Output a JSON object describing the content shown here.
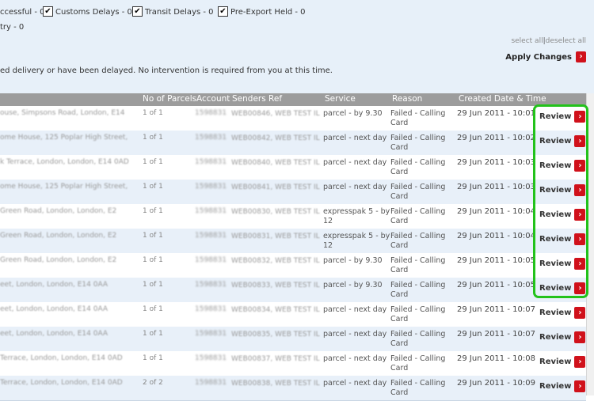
{
  "filters": [
    {
      "label": "ccessful - 0",
      "checked": false
    },
    {
      "label": "Customs Delays - 0",
      "checked": true
    },
    {
      "label": "Transit Delays - 0",
      "checked": true
    },
    {
      "label": "Pre-Export Held - 0",
      "checked": true
    }
  ],
  "filters_line2": "try - 0",
  "select_all": "select all",
  "select_sep": "|",
  "deselect_all": "deselect all",
  "apply_changes": "Apply Changes",
  "notice": "ed delivery or have been delayed. No intervention is required from you at this time.",
  "table": {
    "headers": {
      "parcels": "No of Parcels",
      "account": "Account",
      "senders_ref": "Senders Ref",
      "service": "Service",
      "reason": "Reason",
      "created": "Created Date & Time"
    },
    "review_label": "Review",
    "rows": [
      {
        "address": "ouse, Simpsons Road, London, E14",
        "parcels": "1 of 1",
        "account": "1598831",
        "senders_ref": "WEB00846, WEB TEST IL",
        "service": "parcel - by 9.30",
        "reason": "Failed - Calling Card",
        "created": "29 Jun 2011 - 10:01"
      },
      {
        "address": "ome House, 125 Poplar High Street,",
        "parcels": "1 of 1",
        "account": "1598831",
        "senders_ref": "WEB00842, WEB TEST IL",
        "service": "parcel - next day",
        "reason": "Failed - Calling Card",
        "created": "29 Jun 2011 - 10:02"
      },
      {
        "address": "k Terrace, London, London, E14 0AD",
        "parcels": "1 of 1",
        "account": "1598831",
        "senders_ref": "WEB00840, WEB TEST IL",
        "service": "parcel - next day",
        "reason": "Failed - Calling Card",
        "created": "29 Jun 2011 - 10:03"
      },
      {
        "address": "ome House, 125 Poplar High Street,",
        "parcels": "1 of 1",
        "account": "1598831",
        "senders_ref": "WEB00841, WEB TEST IL",
        "service": "parcel - next day",
        "reason": "Failed - Calling Card",
        "created": "29 Jun 2011 - 10:03"
      },
      {
        "address": "Green Road, London, London, E2",
        "parcels": "1 of 1",
        "account": "1598831",
        "senders_ref": "WEB00830, WEB TEST IL",
        "service": "expresspak 5 - by 12",
        "reason": "Failed - Calling Card",
        "created": "29 Jun 2011 - 10:04"
      },
      {
        "address": "Green Road, London, London, E2",
        "parcels": "1 of 1",
        "account": "1598831",
        "senders_ref": "WEB00831, WEB TEST IL",
        "service": "expresspak 5 - by 12",
        "reason": "Failed - Calling Card",
        "created": "29 Jun 2011 - 10:04"
      },
      {
        "address": "Green Road, London, London, E2",
        "parcels": "1 of 1",
        "account": "1598831",
        "senders_ref": "WEB00832, WEB TEST IL",
        "service": "parcel - by 9.30",
        "reason": "Failed - Calling Card",
        "created": "29 Jun 2011 - 10:05"
      },
      {
        "address": "eet, London, London, E14 0AA",
        "parcels": "1 of 1",
        "account": "1598831",
        "senders_ref": "WEB00833, WEB TEST IL",
        "service": "parcel - by 9.30",
        "reason": "Failed - Calling Card",
        "created": "29 Jun 2011 - 10:05"
      },
      {
        "address": "eet, London, London, E14 0AA",
        "parcels": "1 of 1",
        "account": "1598831",
        "senders_ref": "WEB00834, WEB TEST IL",
        "service": "parcel - next day",
        "reason": "Failed - Calling Card",
        "created": "29 Jun 2011 - 10:07"
      },
      {
        "address": "eet, London, London, E14 0AA",
        "parcels": "1 of 1",
        "account": "1598831",
        "senders_ref": "WEB00835, WEB TEST IL",
        "service": "parcel - next day",
        "reason": "Failed - Calling Card",
        "created": "29 Jun 2011 - 10:07"
      },
      {
        "address": "Terrace, London, London, E14 0AD",
        "parcels": "1 of 1",
        "account": "1598831",
        "senders_ref": "WEB00837, WEB TEST IL",
        "service": "parcel - next day",
        "reason": "Failed - Calling Card",
        "created": "29 Jun 2011 - 10:08"
      },
      {
        "address": "Terrace, London, London, E14 0AD",
        "parcels": "2 of 2",
        "account": "1598831",
        "senders_ref": "WEB00838, WEB TEST IL",
        "service": "parcel - next day",
        "reason": "Failed - Calling Card",
        "created": "29 Jun 2011 - 10:09"
      }
    ]
  },
  "colors": {
    "accent_red": "#d0111b",
    "highlight_green": "#22c21a",
    "header_gray": "#9c9c9c",
    "row_alt": "#e8f0f9"
  },
  "icons": {
    "review_arrow": "chevron-right-icon",
    "apply_arrow": "chevron-right-icon",
    "checkbox": "checkbox-checked-icon"
  }
}
